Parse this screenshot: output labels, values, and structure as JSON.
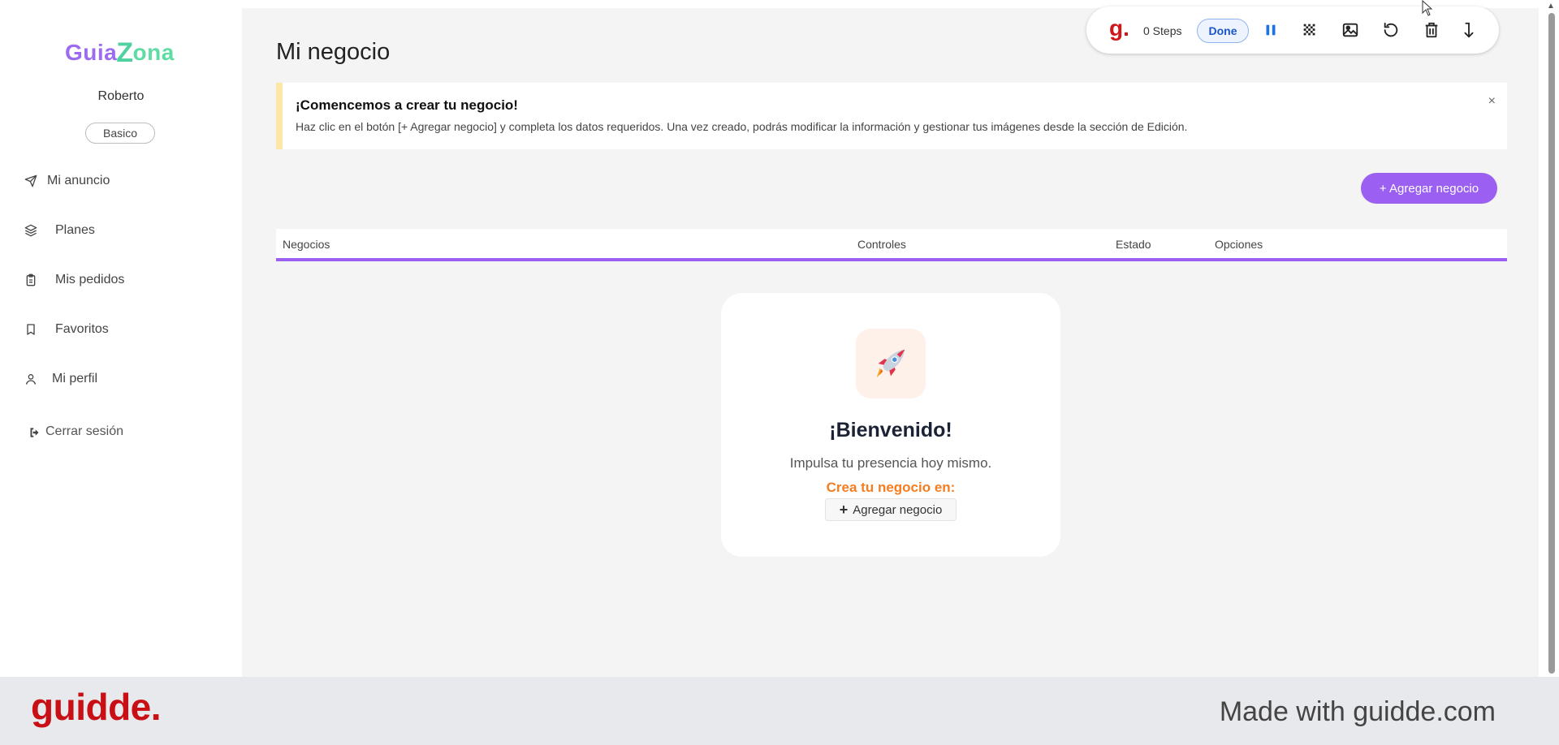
{
  "sidebar": {
    "logo": {
      "part1": "Guia",
      "z": "Z",
      "part2": "ona"
    },
    "username": "Roberto",
    "plan": "Basico",
    "items": [
      {
        "label": "Mi anuncio",
        "icon": "send-icon"
      },
      {
        "label": "Planes",
        "icon": "layers-icon"
      },
      {
        "label": "Mis pedidos",
        "icon": "clipboard-icon"
      },
      {
        "label": "Favoritos",
        "icon": "bookmark-icon"
      },
      {
        "label": "Mi perfil",
        "icon": "user-icon"
      }
    ],
    "logout_label": "Cerrar sesión"
  },
  "main": {
    "title": "Mi negocio",
    "notice": {
      "title": "¡Comencemos a crear tu negocio!",
      "text": "Haz clic en el botón [+ Agregar negocio] y completa los datos requeridos. Una vez creado, podrás modificar la información y gestionar tus imágenes desde la sección de Edición.",
      "close": "×"
    },
    "add_button": "+ Agregar negocio",
    "table": {
      "headers": [
        "Negocios",
        "Controles",
        "Estado",
        "Opciones"
      ]
    },
    "welcome": {
      "icon": "rocket-icon",
      "title": "¡Bienvenido!",
      "subtitle": "Impulsa tu presencia hoy mismo.",
      "cta": "Crea tu negocio en:",
      "button_plus": "+",
      "button_label": "Agregar negocio"
    }
  },
  "recorder": {
    "logo": "g.",
    "steps": "0 Steps",
    "done": "Done"
  },
  "footer": {
    "logo": "guidde.",
    "text": "Made with guidde.com"
  },
  "colors": {
    "accent": "#9b5ff2",
    "notice_border": "#fbe8a6",
    "cta": "#f57d20",
    "guidde_red": "#c80f15"
  }
}
